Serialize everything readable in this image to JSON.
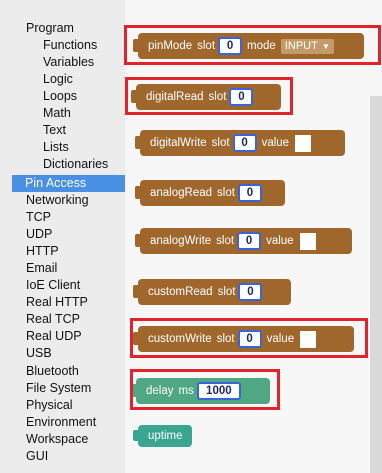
{
  "categories": [
    {
      "label": "Program",
      "level": 1
    },
    {
      "label": "Functions",
      "level": 2
    },
    {
      "label": "Variables",
      "level": 2
    },
    {
      "label": "Logic",
      "level": 2
    },
    {
      "label": "Loops",
      "level": 2
    },
    {
      "label": "Math",
      "level": 2
    },
    {
      "label": "Text",
      "level": 2
    },
    {
      "label": "Lists",
      "level": 2
    },
    {
      "label": "Dictionaries",
      "level": 2
    },
    {
      "label": "Pin Access",
      "level": 1,
      "selected": true
    },
    {
      "label": "Networking",
      "level": 1
    },
    {
      "label": "TCP",
      "level": 1
    },
    {
      "label": "UDP",
      "level": 1
    },
    {
      "label": "HTTP",
      "level": 1
    },
    {
      "label": "Email",
      "level": 1
    },
    {
      "label": "IoE Client",
      "level": 1
    },
    {
      "label": "Real HTTP",
      "level": 1
    },
    {
      "label": "Real TCP",
      "level": 1
    },
    {
      "label": "Real UDP",
      "level": 1
    },
    {
      "label": "USB",
      "level": 1
    },
    {
      "label": "Bluetooth",
      "level": 1
    },
    {
      "label": "File System",
      "level": 1
    },
    {
      "label": "Physical",
      "level": 1
    },
    {
      "label": "Environment",
      "level": 1
    },
    {
      "label": "Workspace",
      "level": 1
    },
    {
      "label": "GUI",
      "level": 1
    }
  ],
  "blocks": {
    "pinMode": {
      "name": "pinMode",
      "slot_label": "slot",
      "slot_value": "0",
      "mode_label": "mode",
      "mode_value": "INPUT"
    },
    "digitalRead": {
      "name": "digitalRead",
      "slot_label": "slot",
      "slot_value": "0"
    },
    "digitalWrite": {
      "name": "digitalWrite",
      "slot_label": "slot",
      "slot_value": "0",
      "value_label": "value"
    },
    "analogRead": {
      "name": "analogRead",
      "slot_label": "slot",
      "slot_value": "0"
    },
    "analogWrite": {
      "name": "analogWrite",
      "slot_label": "slot",
      "slot_value": "0",
      "value_label": "value"
    },
    "customRead": {
      "name": "customRead",
      "slot_label": "slot",
      "slot_value": "0"
    },
    "customWrite": {
      "name": "customWrite",
      "slot_label": "slot",
      "slot_value": "0",
      "value_label": "value"
    },
    "delay": {
      "name": "delay",
      "ms_label": "ms",
      "ms_value": "1000"
    },
    "uptime": {
      "name": "uptime"
    }
  },
  "colors": {
    "highlight": "#e0242d",
    "selected": "#4a90e2",
    "pin_block": "#a0672d",
    "timing_block": "#4fa883"
  }
}
